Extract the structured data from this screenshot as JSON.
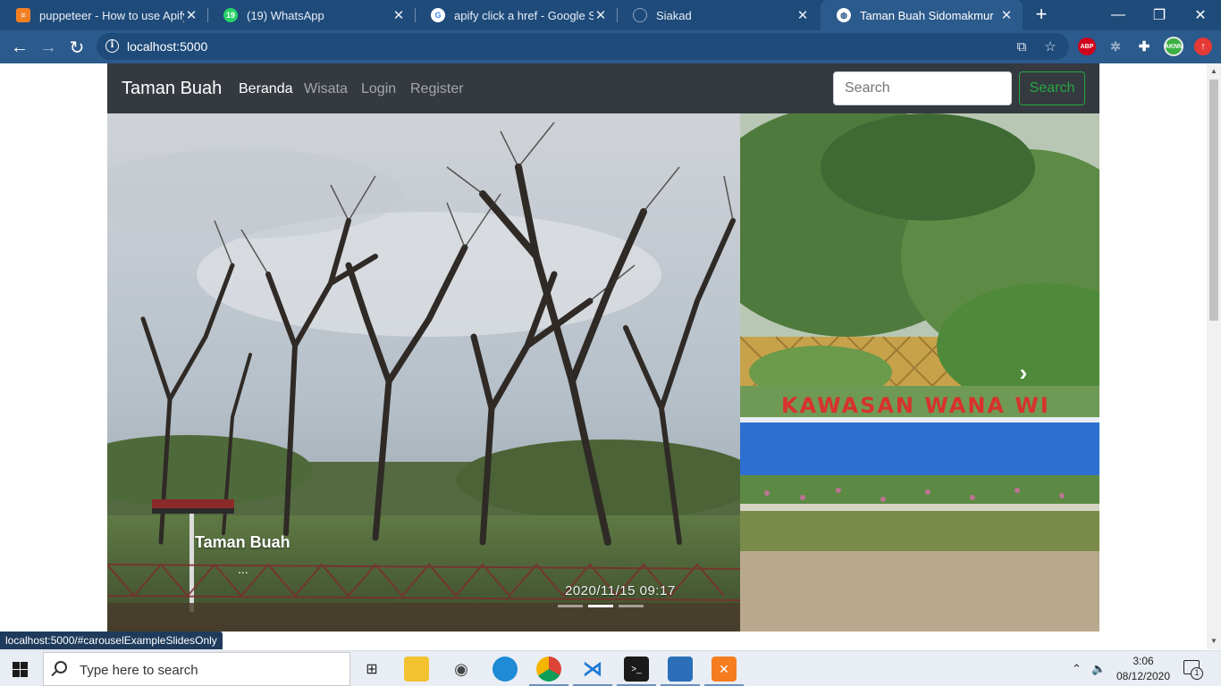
{
  "browser": {
    "tabs": [
      {
        "title": "puppeteer - How to use Apify to",
        "icon": "stackoverflow-icon"
      },
      {
        "title": "(19) WhatsApp",
        "icon": "whatsapp-icon"
      },
      {
        "title": "apify click a href - Google Search",
        "icon": "google-icon"
      },
      {
        "title": "Siakad",
        "icon": "siakad-icon"
      },
      {
        "title": "Taman Buah Sidomakmur",
        "icon": "globe-icon",
        "active": true
      }
    ],
    "url": "localhost:5000",
    "status_url": "localhost:5000/#carouselExampleSlidesOnly",
    "ext_abp": "ABP",
    "ext_avatar": "AKNN"
  },
  "site": {
    "brand": "Taman Buah",
    "nav": [
      "Beranda",
      "Wisata",
      "Login",
      "Register"
    ],
    "search_placeholder": "Search",
    "search_button": "Search"
  },
  "carousel": {
    "caption_title": "Taman Buah",
    "caption_text": "...",
    "timestamp": "2020/11/15 09:17",
    "sign_text": "KAWASAN WANA WI",
    "slide_count": 3,
    "active_slide": 1
  },
  "taskbar": {
    "search_placeholder": "Type here to search",
    "time": "3:06",
    "date": "08/12/2020",
    "notification_count": "1"
  }
}
